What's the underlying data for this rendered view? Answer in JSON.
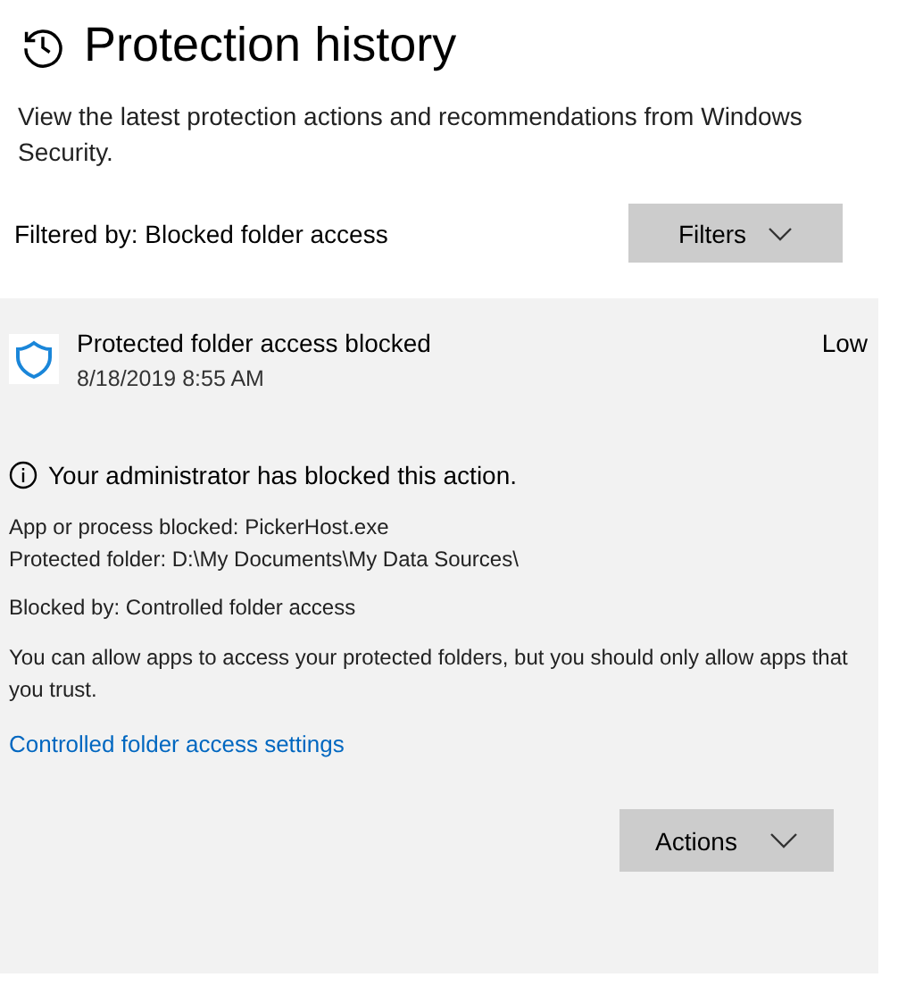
{
  "page": {
    "title": "Protection history",
    "description": "View the latest protection actions and recommendations from Windows Security."
  },
  "filter": {
    "label": "Filtered by: Blocked folder access",
    "button": "Filters"
  },
  "event": {
    "title": "Protected folder access blocked",
    "date": "8/18/2019 8:55 AM",
    "severity": "Low",
    "message": "Your administrator has blocked this action.",
    "details": [
      "App or process blocked: PickerHost.exe",
      "Protected folder: D:\\My Documents\\My Data Sources\\"
    ],
    "blocked_by": "Blocked by: Controlled folder access",
    "note": "You can allow apps to access your protected folders, but you should only allow apps that you trust.",
    "link": "Controlled folder access settings",
    "button": "Actions"
  }
}
